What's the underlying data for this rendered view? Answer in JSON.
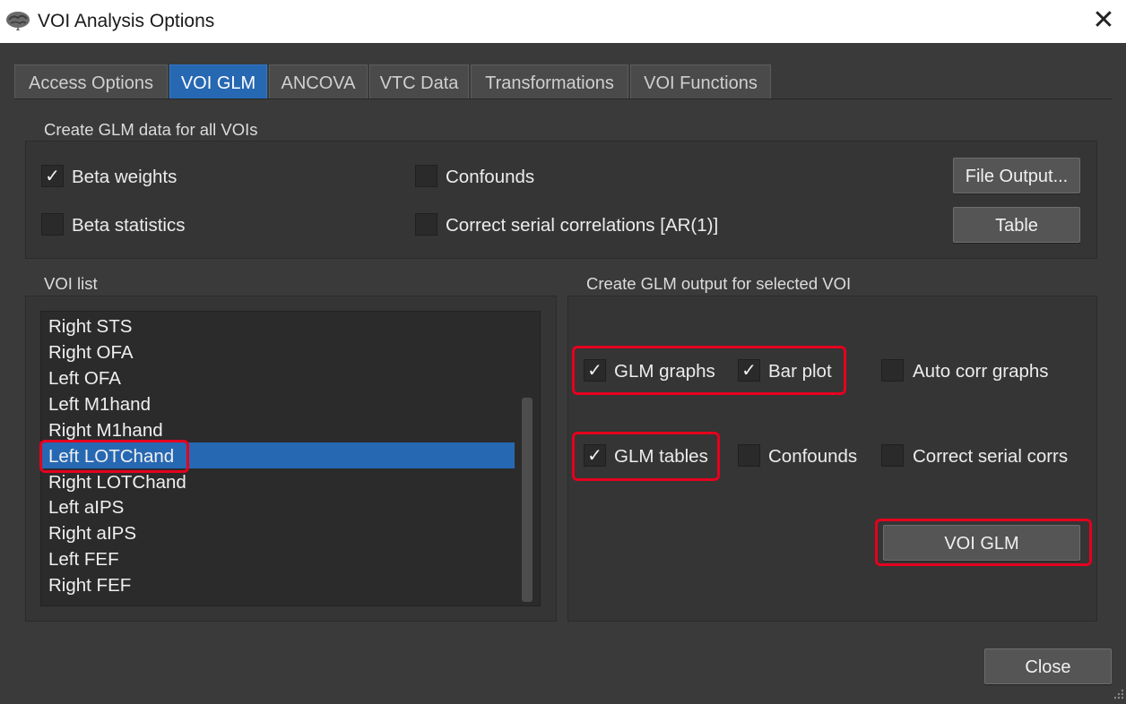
{
  "window": {
    "title": "VOI Analysis Options",
    "icon": "brain-icon",
    "close_glyph": "✕"
  },
  "tabs": [
    {
      "label": "Access Options"
    },
    {
      "label": "VOI GLM",
      "active": true
    },
    {
      "label": "ANCOVA"
    },
    {
      "label": "VTC Data"
    },
    {
      "label": "Transformations"
    },
    {
      "label": "VOI Functions"
    }
  ],
  "glm_all": {
    "title": "Create GLM data for all VOIs",
    "beta_weights": {
      "label": "Beta weights",
      "checked": true
    },
    "beta_statistics": {
      "label": "Beta statistics",
      "checked": false
    },
    "confounds": {
      "label": "Confounds",
      "checked": false
    },
    "serial_corr": {
      "label": "Correct serial correlations [AR(1)]",
      "checked": false
    },
    "file_output_label": "File Output...",
    "table_label": "Table"
  },
  "voi_list": {
    "title": "VOI list",
    "items": [
      "Right STS",
      "Right OFA",
      "Left OFA",
      "Left M1hand",
      "Right M1hand",
      "Left LOTChand",
      "Right LOTChand",
      "Left aIPS",
      "Right aIPS",
      "Left FEF",
      "Right FEF"
    ],
    "selected": "Left LOTChand"
  },
  "glm_selected": {
    "title": "Create GLM output for selected VOI",
    "glm_graphs": {
      "label": "GLM graphs",
      "checked": true
    },
    "bar_plot": {
      "label": "Bar plot",
      "checked": true
    },
    "auto_corr": {
      "label": "Auto corr graphs",
      "checked": false
    },
    "glm_tables": {
      "label": "GLM tables",
      "checked": true
    },
    "confounds": {
      "label": "Confounds",
      "checked": false
    },
    "serial_corrs": {
      "label": "Correct serial corrs",
      "checked": false
    },
    "voi_glm_label": "VOI GLM"
  },
  "footer": {
    "close_label": "Close"
  },
  "check_glyph": "✓",
  "colors": {
    "accent": "#2768b3",
    "highlight": "#e5001e",
    "background": "#3a3a3a"
  }
}
